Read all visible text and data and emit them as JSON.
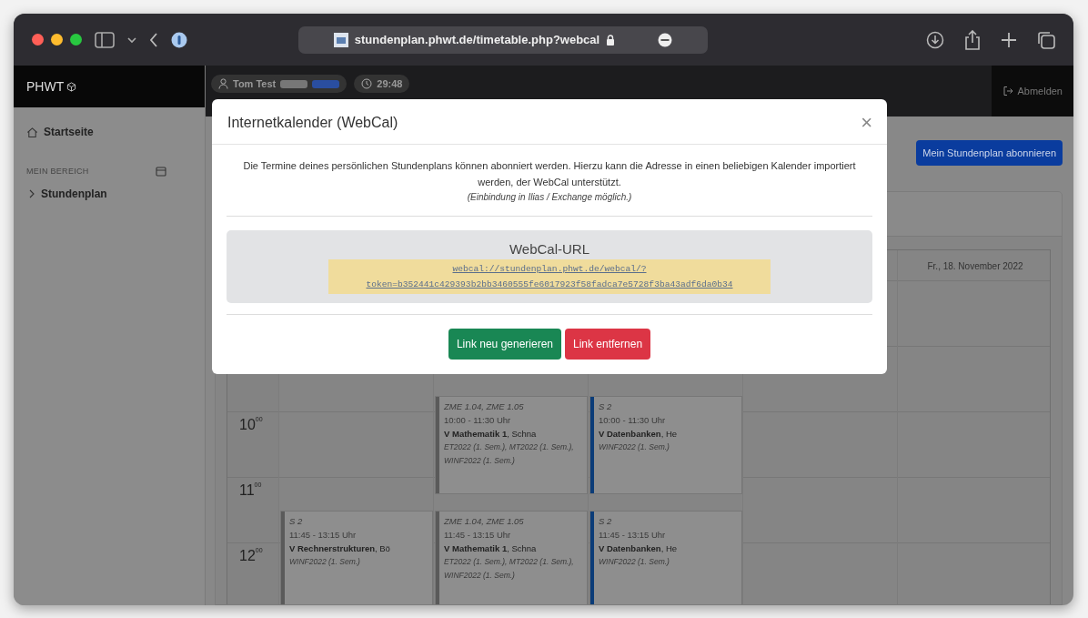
{
  "browser": {
    "url": "stundenplan.phwt.de/timetable.php?webcal"
  },
  "app": {
    "brand": "PHWT",
    "user": "Tom Test",
    "timer": "29:48",
    "logout": "Abmelden"
  },
  "sidebar": {
    "items": [
      {
        "label": "Startseite",
        "selected": false
      }
    ],
    "section": "MEIN BEREICH",
    "section_items": [
      {
        "label": "Stundenplan",
        "expanded": false
      }
    ]
  },
  "subscribe_button": "Mein Stundenplan abonnieren",
  "calendar": {
    "hours": [
      "10$^{00}$",
      "11$^{00}$",
      "12$^{00}$"
    ],
    "days": [
      {
        "events": [
          {
            "kind": "midday",
            "color": "#5a5a5a",
            "room": "S 2",
            "time": "11:45 - 13:15 Uhr",
            "title": "**V Rechnerstrukturen**, Bö",
            "groups": "WINF2022 (1. Sem.)"
          }
        ]
      },
      {
        "events": [
          {
            "kind": "morning",
            "color": "#5a5a5a",
            "room": "ZME 1.04, ZME 1.05",
            "time": "10:00 - 11:30 Uhr",
            "title": "**V Mathematik 1**, Schna",
            "groups": "ET2022 (1. Sem.), MT2022 (1. Sem.), WINF2022 (1. Sem.)"
          },
          {
            "kind": "midday",
            "color": "#5a5a5a",
            "room": "ZME 1.04, ZME 1.05",
            "time": "11:45 - 13:15 Uhr",
            "title": "**V Mathematik 1**, Schna",
            "groups": "ET2022 (1. Sem.), MT2022 (1. Sem.), WINF2022 (1. Sem.)"
          }
        ]
      },
      {
        "events": [
          {
            "kind": "morning",
            "color": "#0b3c78",
            "room": "S 2",
            "time": "10:00 - 11:30 Uhr",
            "title": "**V Datenbanken**, He",
            "groups": "WINF2022 (1. Sem.)"
          },
          {
            "kind": "midday",
            "color": "#0b3c78",
            "room": "S 2",
            "time": "11:45 - 13:15 Uhr",
            "title": "**V Datenbanken**, He",
            "groups": "WINF2022 (1. Sem.)"
          }
        ]
      }
    ],
    "friday_header": "Fr., 18. November 2022"
  },
  "modal": {
    "title": "Internetkalender (WebCal)",
    "close": "×",
    "description": "Die Termine deines persönlichen Stundenplans können abonniert werden. Hierzu kann die Adresse in einen beliebigen Kalender importiert werden, der WebCal unterstützt.",
    "note": "(Einbindung in Ilias / Exchange möglich.)",
    "url_heading": "WebCal-URL",
    "url": "webcal://stundenplan.phwt.de/webcal/?token=b352441c429393b2bb3460555fe6017923f58fadca7e5728f3ba43adf6da0b34",
    "buttons": [
      {
        "label": "Link neu generieren",
        "kind": "success"
      },
      {
        "label": "Link entfernen",
        "kind": "danger"
      }
    ]
  }
}
